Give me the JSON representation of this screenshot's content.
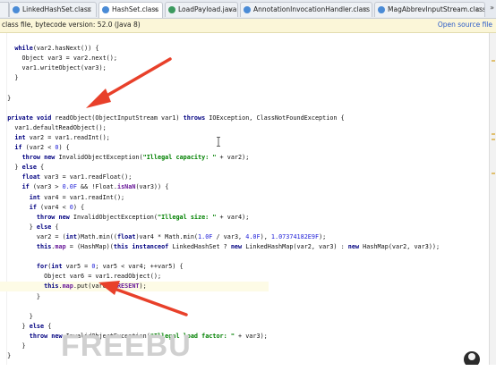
{
  "tabs": [
    {
      "label": "LinkedHashSet.class",
      "icon_color": "#4a8bd6",
      "active": false
    },
    {
      "label": "HashSet.class",
      "icon_color": "#4a8bd6",
      "active": true
    },
    {
      "label": "LoadPayload.java",
      "icon_color": "#3c9a5f",
      "active": false
    },
    {
      "label": "AnnotationInvocationHandler.class",
      "icon_color": "#4a8bd6",
      "active": false
    },
    {
      "label": "MagAbbrevInputStream.class",
      "icon_color": "#4a8bd6",
      "active": false
    }
  ],
  "tab_more": "»",
  "tab_close": "×",
  "infobar": {
    "message": "class file, bytecode version: 52.0 (Java 8)",
    "link": "Open source file"
  },
  "code_lines": [
    [
      {
        "t": "    "
      },
      {
        "t": "while",
        "c": "kw"
      },
      {
        "t": "(var2.hasNext()) {"
      }
    ],
    [
      {
        "t": "      Object var3 = var2.next();"
      }
    ],
    [
      {
        "t": "      var1.writeObject(var3);"
      }
    ],
    [
      {
        "t": "    }"
      }
    ],
    [
      {
        "t": ""
      }
    ],
    [
      {
        "t": "  }"
      }
    ],
    [
      {
        "t": ""
      }
    ],
    [
      {
        "t": "  "
      },
      {
        "t": "private void",
        "c": "kw"
      },
      {
        "t": " readObject(ObjectInputStream var1) "
      },
      {
        "t": "throws",
        "c": "kw"
      },
      {
        "t": " IOException, ClassNotFoundException {"
      }
    ],
    [
      {
        "t": "    var1.defaultReadObject();"
      }
    ],
    [
      {
        "t": "    "
      },
      {
        "t": "int",
        "c": "kw"
      },
      {
        "t": " var2 = var1.readInt();"
      }
    ],
    [
      {
        "t": "    "
      },
      {
        "t": "if",
        "c": "kw"
      },
      {
        "t": " (var2 < "
      },
      {
        "t": "0",
        "c": "num"
      },
      {
        "t": ") {"
      }
    ],
    [
      {
        "t": "      "
      },
      {
        "t": "throw new",
        "c": "kw"
      },
      {
        "t": " InvalidObjectException("
      },
      {
        "t": "\"Illegal capacity: \"",
        "c": "str"
      },
      {
        "t": " + var2);"
      }
    ],
    [
      {
        "t": "    } "
      },
      {
        "t": "else",
        "c": "kw"
      },
      {
        "t": " {"
      }
    ],
    [
      {
        "t": "      "
      },
      {
        "t": "float",
        "c": "kw"
      },
      {
        "t": " var3 = var1.readFloat();"
      }
    ],
    [
      {
        "t": "      "
      },
      {
        "t": "if",
        "c": "kw"
      },
      {
        "t": " (var3 > "
      },
      {
        "t": "0.0F",
        "c": "num"
      },
      {
        "t": " && !Float."
      },
      {
        "t": "isNaN",
        "c": "fld"
      },
      {
        "t": "(var3)) {"
      }
    ],
    [
      {
        "t": "        "
      },
      {
        "t": "int",
        "c": "kw"
      },
      {
        "t": " var4 = var1.readInt();"
      }
    ],
    [
      {
        "t": "        "
      },
      {
        "t": "if",
        "c": "kw"
      },
      {
        "t": " (var4 < "
      },
      {
        "t": "0",
        "c": "num"
      },
      {
        "t": ") {"
      }
    ],
    [
      {
        "t": "          "
      },
      {
        "t": "throw new",
        "c": "kw"
      },
      {
        "t": " InvalidObjectException("
      },
      {
        "t": "\"Illegal size: \"",
        "c": "str"
      },
      {
        "t": " + var4);"
      }
    ],
    [
      {
        "t": "        } "
      },
      {
        "t": "else",
        "c": "kw"
      },
      {
        "t": " {"
      }
    ],
    [
      {
        "t": "          var2 = ("
      },
      {
        "t": "int",
        "c": "kw"
      },
      {
        "t": ")Math.min(("
      },
      {
        "t": "float",
        "c": "kw"
      },
      {
        "t": ")var4 * Math.min("
      },
      {
        "t": "1.0F",
        "c": "num"
      },
      {
        "t": " / var3, "
      },
      {
        "t": "4.0F",
        "c": "num"
      },
      {
        "t": "), "
      },
      {
        "t": "1.07374182E9F",
        "c": "num"
      },
      {
        "t": ");"
      }
    ],
    [
      {
        "t": "          "
      },
      {
        "t": "this",
        "c": "kw"
      },
      {
        "t": "."
      },
      {
        "t": "map",
        "c": "fld"
      },
      {
        "t": " = (HashMap)("
      },
      {
        "t": "this instanceof",
        "c": "kw"
      },
      {
        "t": " LinkedHashSet ? "
      },
      {
        "t": "new",
        "c": "kw"
      },
      {
        "t": " LinkedHashMap(var2, var3) : "
      },
      {
        "t": "new",
        "c": "kw"
      },
      {
        "t": " HashMap(var2, var3));"
      }
    ],
    [
      {
        "t": ""
      }
    ],
    [
      {
        "t": "          "
      },
      {
        "t": "for",
        "c": "kw"
      },
      {
        "t": "("
      },
      {
        "t": "int",
        "c": "kw"
      },
      {
        "t": " var5 = "
      },
      {
        "t": "0",
        "c": "num"
      },
      {
        "t": "; var5 < var4; ++var5) {"
      }
    ],
    [
      {
        "t": "            Object var6 = var1.readObject();"
      }
    ],
    [
      {
        "t": "            "
      },
      {
        "t": "this",
        "c": "kw"
      },
      {
        "t": "."
      },
      {
        "t": "map",
        "c": "fld"
      },
      {
        "t": ".put(var6, "
      },
      {
        "t": "PRESENT",
        "c": "fld"
      },
      {
        "t": ");"
      }
    ],
    [
      {
        "t": "          }"
      }
    ],
    [
      {
        "t": ""
      }
    ],
    [
      {
        "t": "        }"
      }
    ],
    [
      {
        "t": "      } "
      },
      {
        "t": "else",
        "c": "kw"
      },
      {
        "t": " {"
      }
    ],
    [
      {
        "t": "        "
      },
      {
        "t": "throw new",
        "c": "kw"
      },
      {
        "t": " InvalidObjectException("
      },
      {
        "t": "\"Illegal load factor: \"",
        "c": "str"
      },
      {
        "t": " + var3);"
      }
    ],
    [
      {
        "t": "      }"
      }
    ],
    [
      {
        "t": "  }"
      }
    ],
    [
      {
        "t": ""
      }
    ]
  ],
  "highlighted_line": 24,
  "watermark": "FREEBUF",
  "colors": {
    "arrow": "#e8402a",
    "watermark": "#d0d0d0"
  },
  "icons": {
    "tab_file": "class-file-icon",
    "cursor": "text-cursor-icon",
    "arrow": "annotation-arrow"
  }
}
